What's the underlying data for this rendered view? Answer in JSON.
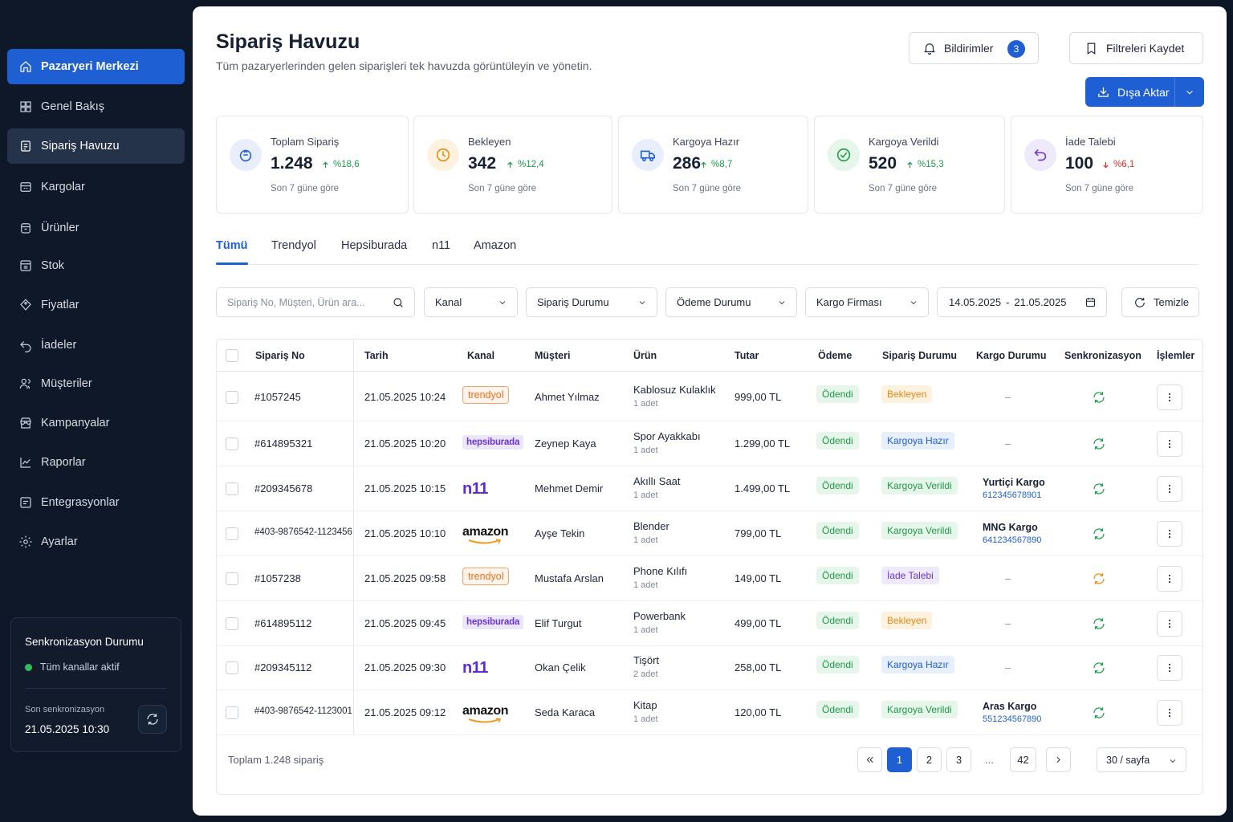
{
  "sidebar": {
    "items": [
      {
        "label": "Pazaryeri Merkezi",
        "icon": "home-icon"
      },
      {
        "label": "Genel Bakış",
        "icon": "grid-icon"
      },
      {
        "label": "Sipariş Havuzu",
        "icon": "orders-icon"
      },
      {
        "label": "Kargolar",
        "icon": "cargo-icon"
      },
      {
        "label": "Ürünler",
        "icon": "box-icon"
      },
      {
        "label": "Stok",
        "icon": "stock-icon"
      },
      {
        "label": "Fiyatlar",
        "icon": "tag-icon"
      },
      {
        "label": "İadeler",
        "icon": "return-icon"
      },
      {
        "label": "Müşteriler",
        "icon": "users-icon"
      },
      {
        "label": "Kampanyalar",
        "icon": "store-icon"
      },
      {
        "label": "Raporlar",
        "icon": "chart-icon"
      },
      {
        "label": "Entegrasyonlar",
        "icon": "integration-icon"
      },
      {
        "label": "Ayarlar",
        "icon": "gear-icon"
      }
    ],
    "sync": {
      "title": "Senkronizasyon Durumu",
      "status": "Tüm kanallar aktif",
      "last_label": "Son senkronizasyon",
      "last_time": "21.05.2025 10:30"
    }
  },
  "header": {
    "title": "Sipariş Havuzu",
    "subtitle": "Tüm pazaryerlerinden gelen siparişleri tek havuzda görüntüleyin ve yönetin.",
    "notifications_label": "Bildirimler",
    "notifications_count": "3",
    "save_filters_label": "Filtreleri Kaydet",
    "export_label": "Dışa Aktar"
  },
  "stats": [
    {
      "label": "Toplam Sipariş",
      "value": "1.248",
      "delta": "%18,6",
      "dir": "up",
      "note": "Son 7 güne göre",
      "color": "#1f5fd4"
    },
    {
      "label": "Bekleyen",
      "value": "342",
      "delta": "%12,4",
      "dir": "up",
      "note": "Son 7 güne göre",
      "color": "#e38b13"
    },
    {
      "label": "Kargoya Hazır",
      "value": "286",
      "delta": "%8,7",
      "dir": "up",
      "note": "Son 7 güne göre",
      "color": "#1f5fd4"
    },
    {
      "label": "Kargoya Verildi",
      "value": "520",
      "delta": "%15,3",
      "dir": "up",
      "note": "Son 7 güne göre",
      "color": "#1e9a48"
    },
    {
      "label": "İade Talebi",
      "value": "100",
      "delta": "%6,1",
      "dir": "down",
      "note": "Son 7 güne göre",
      "color": "#6a35d6"
    }
  ],
  "tabs": [
    "Tümü",
    "Trendyol",
    "Hepsiburada",
    "n11",
    "Amazon"
  ],
  "filters": {
    "search_placeholder": "Sipariş No, Müşteri, Ürün ara...",
    "channel": "Kanal",
    "order_status": "Sipariş Durumu",
    "payment_status": "Ödeme Durumu",
    "cargo_company": "Kargo Firması",
    "date_from": "14.05.2025",
    "date_sep": "-",
    "date_to": "21.05.2025",
    "clear_label": "Temizle"
  },
  "table": {
    "columns": [
      "Sipariş No",
      "Tarih",
      "Kanal",
      "Müşteri",
      "Ürün",
      "Tutar",
      "Ödeme",
      "Sipariş Durumu",
      "Kargo Durumu",
      "Senkronizasyon",
      "İşlemler"
    ],
    "rows": [
      {
        "id": "#1057245",
        "date": "21.05.2025 10:24",
        "channel": "trendyol",
        "customer": "Ahmet Yılmaz",
        "product": "Kablosuz Kulaklık",
        "qty": "1 adet",
        "amount": "999,00 TL",
        "payment": "Ödendi",
        "status": "Bekleyen",
        "status_type": "pending",
        "cargo": "–",
        "track": "",
        "sync": "ok"
      },
      {
        "id": "#614895321",
        "date": "21.05.2025 10:20",
        "channel": "hepsiburada",
        "customer": "Zeynep Kaya",
        "product": "Spor Ayakkabı",
        "qty": "1 adet",
        "amount": "1.299,00 TL",
        "payment": "Ödendi",
        "status": "Kargoya Hazır",
        "status_type": "ready",
        "cargo": "–",
        "track": "",
        "sync": "ok"
      },
      {
        "id": "#209345678",
        "date": "21.05.2025 10:15",
        "channel": "n11",
        "customer": "Mehmet Demir",
        "product": "Akıllı Saat",
        "qty": "1 adet",
        "amount": "1.499,00 TL",
        "payment": "Ödendi",
        "status": "Kargoya Verildi",
        "status_type": "shipped",
        "cargo": "Yurtiçi Kargo",
        "track": "612345678901",
        "sync": "ok"
      },
      {
        "id": "#403-9876542-1123456",
        "date": "21.05.2025 10:10",
        "channel": "amazon",
        "customer": "Ayşe Tekin",
        "product": "Blender",
        "qty": "1 adet",
        "amount": "799,00 TL",
        "payment": "Ödendi",
        "status": "Kargoya Verildi",
        "status_type": "shipped",
        "cargo": "MNG Kargo",
        "track": "641234567890",
        "sync": "ok"
      },
      {
        "id": "#1057238",
        "date": "21.05.2025 09:58",
        "channel": "trendyol",
        "customer": "Mustafa Arslan",
        "product": "Phone Kılıfı",
        "qty": "1 adet",
        "amount": "149,00 TL",
        "payment": "Ödendi",
        "status": "İade Talebi",
        "status_type": "return",
        "cargo": "–",
        "track": "",
        "sync": "warn"
      },
      {
        "id": "#614895112",
        "date": "21.05.2025 09:45",
        "channel": "hepsiburada",
        "customer": "Elif Turgut",
        "product": "Powerbank",
        "qty": "1 adet",
        "amount": "499,00 TL",
        "payment": "Ödendi",
        "status": "Bekleyen",
        "status_type": "pending",
        "cargo": "–",
        "track": "",
        "sync": "ok"
      },
      {
        "id": "#209345112",
        "date": "21.05.2025 09:30",
        "channel": "n11",
        "customer": "Okan Çelik",
        "product": "Tişört",
        "qty": "2 adet",
        "amount": "258,00 TL",
        "payment": "Ödendi",
        "status": "Kargoya Hazır",
        "status_type": "ready",
        "cargo": "–",
        "track": "",
        "sync": "ok"
      },
      {
        "id": "#403-9876542-1123001",
        "date": "21.05.2025 09:12",
        "channel": "amazon",
        "customer": "Seda Karaca",
        "product": "Kitap",
        "qty": "1 adet",
        "amount": "120,00 TL",
        "payment": "Ödendi",
        "status": "Kargoya Verildi",
        "status_type": "shipped",
        "cargo": "Aras Kargo",
        "track": "551234567890",
        "sync": "ok"
      }
    ],
    "total_label": "Toplam 1.248 sipariş",
    "pages": [
      "1",
      "2",
      "3"
    ],
    "pages_dots": "...",
    "last_page": "42",
    "per_page": "30 / sayfa"
  },
  "channel_labels": {
    "trendyol": "trendyol",
    "hepsiburada": "hepsiburada",
    "n11": "n11",
    "amazon": "amazon"
  },
  "colors": {
    "accent": "#1f5fd4",
    "success": "#1e9a48",
    "warning": "#e38b13",
    "danger": "#d92d2d",
    "purple": "#6a35d6"
  }
}
